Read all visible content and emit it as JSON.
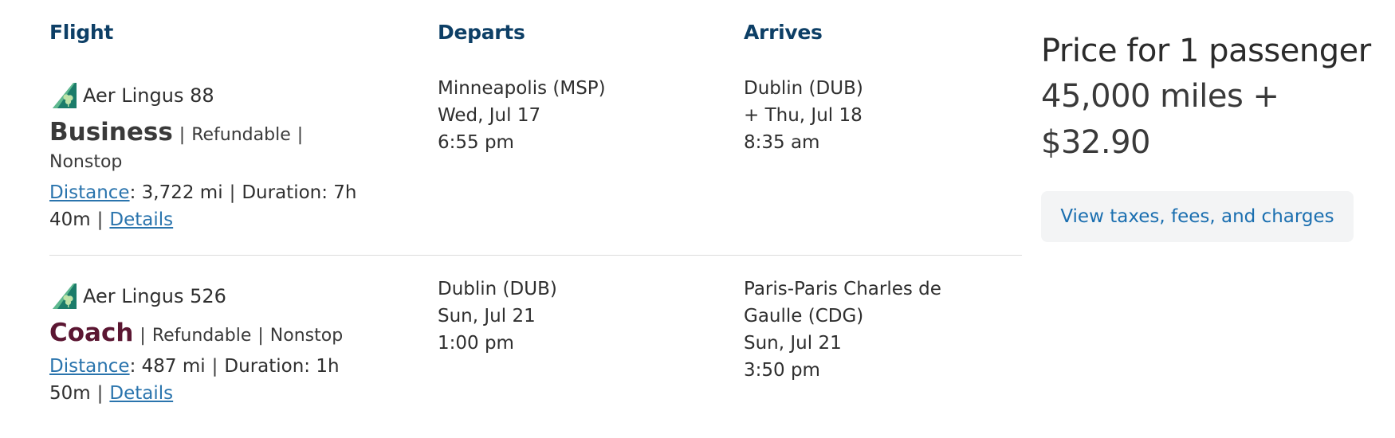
{
  "headers": {
    "flight": "Flight",
    "departs": "Departs",
    "arrives": "Arrives"
  },
  "segments": [
    {
      "airline": "Aer Lingus 88",
      "cabin": "Business",
      "refundable": "Refundable",
      "stops": "Nonstop",
      "distance_label": "Distance",
      "distance_value": ": 3,722 mi",
      "duration_a": "Duration: 7h",
      "duration_b": "40m",
      "details": "Details",
      "depart": {
        "city": "Minneapolis (MSP)",
        "date": "Wed, Jul 17",
        "time": "6:55 pm"
      },
      "arrive": {
        "city": "Dublin (DUB)",
        "date": "+ Thu, Jul 18",
        "time": "8:35 am"
      }
    },
    {
      "airline": "Aer Lingus 526",
      "cabin": "Coach",
      "refundable": "Refundable",
      "stops": "Nonstop",
      "distance_label": "Distance",
      "distance_value": ": 487 mi",
      "duration_a": "Duration: 1h",
      "duration_b": "50m",
      "details": "Details",
      "depart": {
        "city": "Dublin (DUB)",
        "date": "Sun, Jul 21",
        "time": "1:00 pm"
      },
      "arrive": {
        "city_line1": "Paris-Paris Charles de",
        "city_line2": "Gaulle (CDG)",
        "date": "Sun, Jul 21",
        "time": "3:50 pm"
      }
    }
  ],
  "price": {
    "title": "Price for 1 passenger",
    "miles": "45,000 miles +",
    "cash": "$32.90"
  },
  "fees_button": "View taxes, fees, and charges",
  "colors": {
    "header": "#0d3f66",
    "link": "#2a74ad",
    "coach": "#5b1632",
    "button_text": "#1b6fb0"
  },
  "icons": {
    "airline": "aer-lingus-tail-icon"
  }
}
